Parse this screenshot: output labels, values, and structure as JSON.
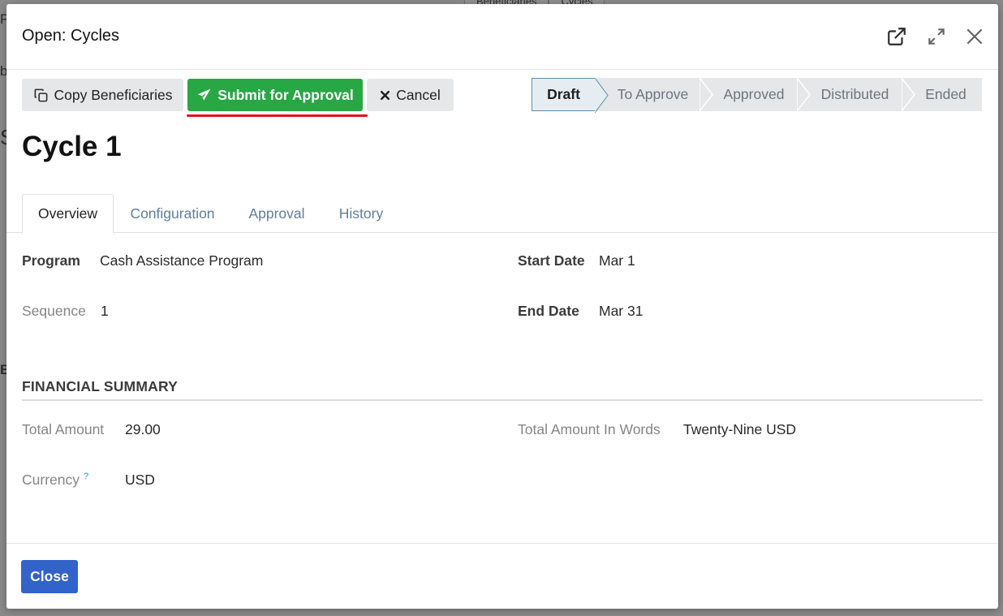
{
  "background": {
    "tabs": [
      "Beneficiaries",
      "Cycles"
    ],
    "fragments": [
      "Pr",
      "b",
      "S",
      "B"
    ]
  },
  "modal": {
    "title": "Open: Cycles",
    "header_icons": [
      "external-link-icon",
      "expand-icon",
      "close-icon"
    ]
  },
  "toolbar": {
    "copy_label": "Copy Beneficiaries",
    "submit_label": "Submit for Approval",
    "cancel_label": "Cancel"
  },
  "statusbar": {
    "stages": [
      "Draft",
      "To Approve",
      "Approved",
      "Distributed",
      "Ended"
    ],
    "active": "Draft"
  },
  "record": {
    "title": "Cycle 1"
  },
  "tabs": [
    "Overview",
    "Configuration",
    "Approval",
    "History"
  ],
  "overview": {
    "program_label": "Program",
    "program_value": "Cash Assistance Program",
    "sequence_label": "Sequence",
    "sequence_value": "1",
    "start_label": "Start Date",
    "start_value": "Mar 1",
    "end_label": "End Date",
    "end_value": "Mar 31"
  },
  "financial": {
    "section_title": "FINANCIAL SUMMARY",
    "total_label": "Total Amount",
    "total_value": "29.00",
    "words_label": "Total Amount In Words",
    "words_value": "Twenty-Nine USD",
    "currency_label": "Currency",
    "currency_help": "?",
    "currency_value": "USD"
  },
  "footer": {
    "close_label": "Close"
  },
  "colors": {
    "success": "#28a745",
    "primary": "#3263c8",
    "highlight_underline": "#e8101a",
    "tab_link": "#5d7f9d"
  }
}
